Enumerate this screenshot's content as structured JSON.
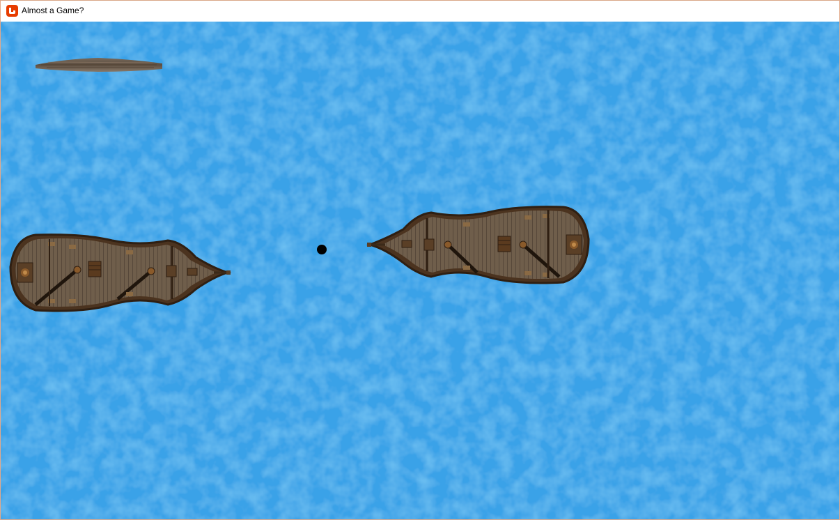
{
  "window": {
    "title": "Almost a Game?",
    "icon": "monogame-icon"
  },
  "colors": {
    "water": "#3aa2e8",
    "water_light": "#52b2f0",
    "water_dark": "#2e93db",
    "hull": "#5a3f26",
    "deck": "#6e5d4a",
    "rail": "#3b2a19",
    "cannonball": "#000000"
  },
  "scene": {
    "objects": [
      "floating-plank",
      "left-ship",
      "right-ship",
      "cannonball"
    ]
  }
}
